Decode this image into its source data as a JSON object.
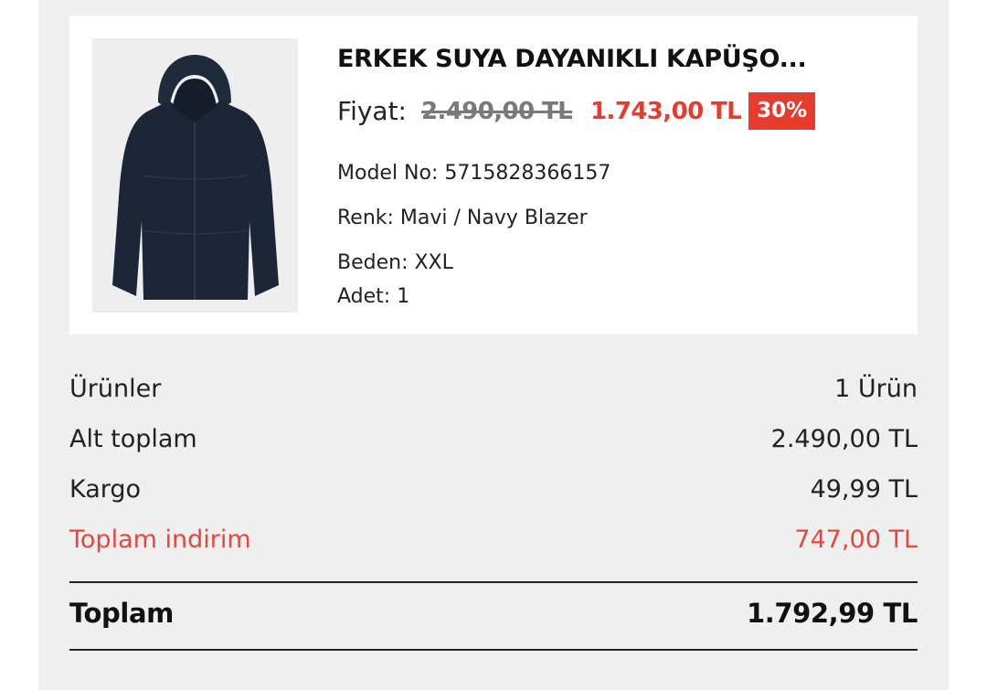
{
  "product": {
    "title": "ERKEK SUYA DAYANIKLI KAPÜŞO...",
    "image_alt": "jacket-image",
    "price_label": "Fiyat:",
    "old_price": "2.490,00 TL",
    "new_price": "1.743,00 TL",
    "discount_badge": "30%",
    "model_no": "Model No: 5715828366157",
    "color": "Renk: Mavi / Navy Blazer",
    "size": "Beden: XXL",
    "quantity": "Adet: 1"
  },
  "summary": {
    "items_label": "Ürünler",
    "items_value": "1 Ürün",
    "subtotal_label": "Alt toplam",
    "subtotal_value": "2.490,00 TL",
    "shipping_label": "Kargo",
    "shipping_value": "49,99 TL",
    "discount_label": "Toplam indirim",
    "discount_value": "747,00 TL",
    "total_label": "Toplam",
    "total_value": "1.792,99 TL"
  },
  "colors": {
    "accent": "#e53c2f",
    "page_bg": "#efefef",
    "card_bg": "#ffffff"
  }
}
